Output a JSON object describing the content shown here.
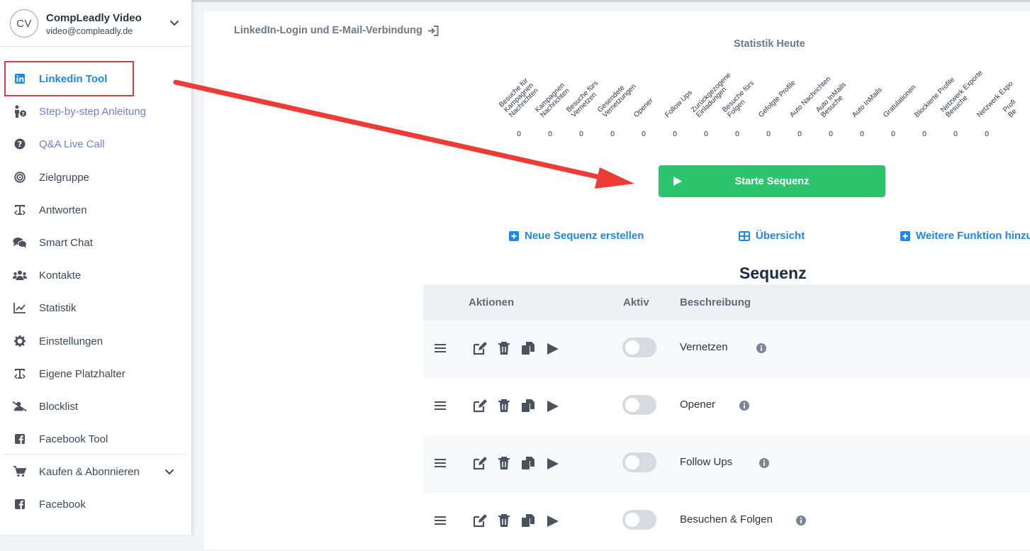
{
  "profile": {
    "initials": "CV",
    "name": "CompLeadly Video",
    "email": "video@compleadly.de"
  },
  "nav": {
    "items": [
      {
        "label": "Linkedin Tool",
        "icon": "linkedin-icon"
      },
      {
        "label": "Step-by-step Anleitung",
        "icon": "person-question-icon"
      },
      {
        "label": "Q&A Live Call",
        "icon": "question-circle-icon"
      },
      {
        "label": "Zielgruppe",
        "icon": "target-icon"
      },
      {
        "label": "Antworten",
        "icon": "text-cursor-icon"
      },
      {
        "label": "Smart Chat",
        "icon": "chat-bubbles-icon"
      },
      {
        "label": "Kontakte",
        "icon": "users-icon"
      },
      {
        "label": "Statistik",
        "icon": "line-chart-icon"
      },
      {
        "label": "Einstellungen",
        "icon": "gear-icon"
      },
      {
        "label": "Eigene Platzhalter",
        "icon": "text-cursor-icon"
      },
      {
        "label": "Blocklist",
        "icon": "user-block-icon"
      },
      {
        "label": "Facebook Tool",
        "icon": "facebook-icon"
      },
      {
        "label": "Kaufen & Abonnieren",
        "icon": "cart-icon"
      },
      {
        "label": "Facebook",
        "icon": "facebook-icon"
      }
    ]
  },
  "header": {
    "login_link": "LinkedIn-Login und E-Mail-Verbindung",
    "stats_title": "Statistik Heute"
  },
  "stats": [
    {
      "label": "Besuche für\nKampagnen\nNachrichten",
      "value": "0"
    },
    {
      "label": "Kampagnen\nNachrichten",
      "value": "0"
    },
    {
      "label": "Besuche fürs\nVernetzen",
      "value": "0"
    },
    {
      "label": "Gesendete\nVernetzungen",
      "value": "0"
    },
    {
      "label": "Opener",
      "value": "0"
    },
    {
      "label": "Follow Ups",
      "value": "0"
    },
    {
      "label": "Zurückgezogene\nEinladungen",
      "value": "0"
    },
    {
      "label": "Besuche fürs\nFolgen",
      "value": "0"
    },
    {
      "label": "Gefolgte Profile",
      "value": "0"
    },
    {
      "label": "Auto Nachrichten",
      "value": "0"
    },
    {
      "label": "Auto InMails\nBesuche",
      "value": "0"
    },
    {
      "label": "Auto InMails",
      "value": "0"
    },
    {
      "label": "Gratulationen",
      "value": "0"
    },
    {
      "label": "Blockierte Profile",
      "value": "0"
    },
    {
      "label": "Netzwerk Exporte\nBesuche",
      "value": "0"
    },
    {
      "label": "Netzwerk Expo",
      "value": "0"
    },
    {
      "label": "Profi\nBe",
      "value": ""
    }
  ],
  "start_button": "Starte Sequenz",
  "actions": {
    "new_sequence": "Neue Sequenz erstellen",
    "overview": "Übersicht",
    "more_functions": "Weitere Funktion hinzu"
  },
  "sequence": {
    "title": "Sequenz",
    "columns": {
      "actions": "Aktionen",
      "active": "Aktiv",
      "description": "Beschreibung"
    },
    "rows": [
      {
        "description": "Vernetzen",
        "active": false
      },
      {
        "description": "Opener",
        "active": false
      },
      {
        "description": "Follow Ups",
        "active": false
      },
      {
        "description": "Besuchen & Folgen",
        "active": false
      }
    ]
  },
  "colors": {
    "accent_blue": "#1f88e5",
    "start_green": "#2dc46e",
    "highlight_red": "#e53935"
  }
}
